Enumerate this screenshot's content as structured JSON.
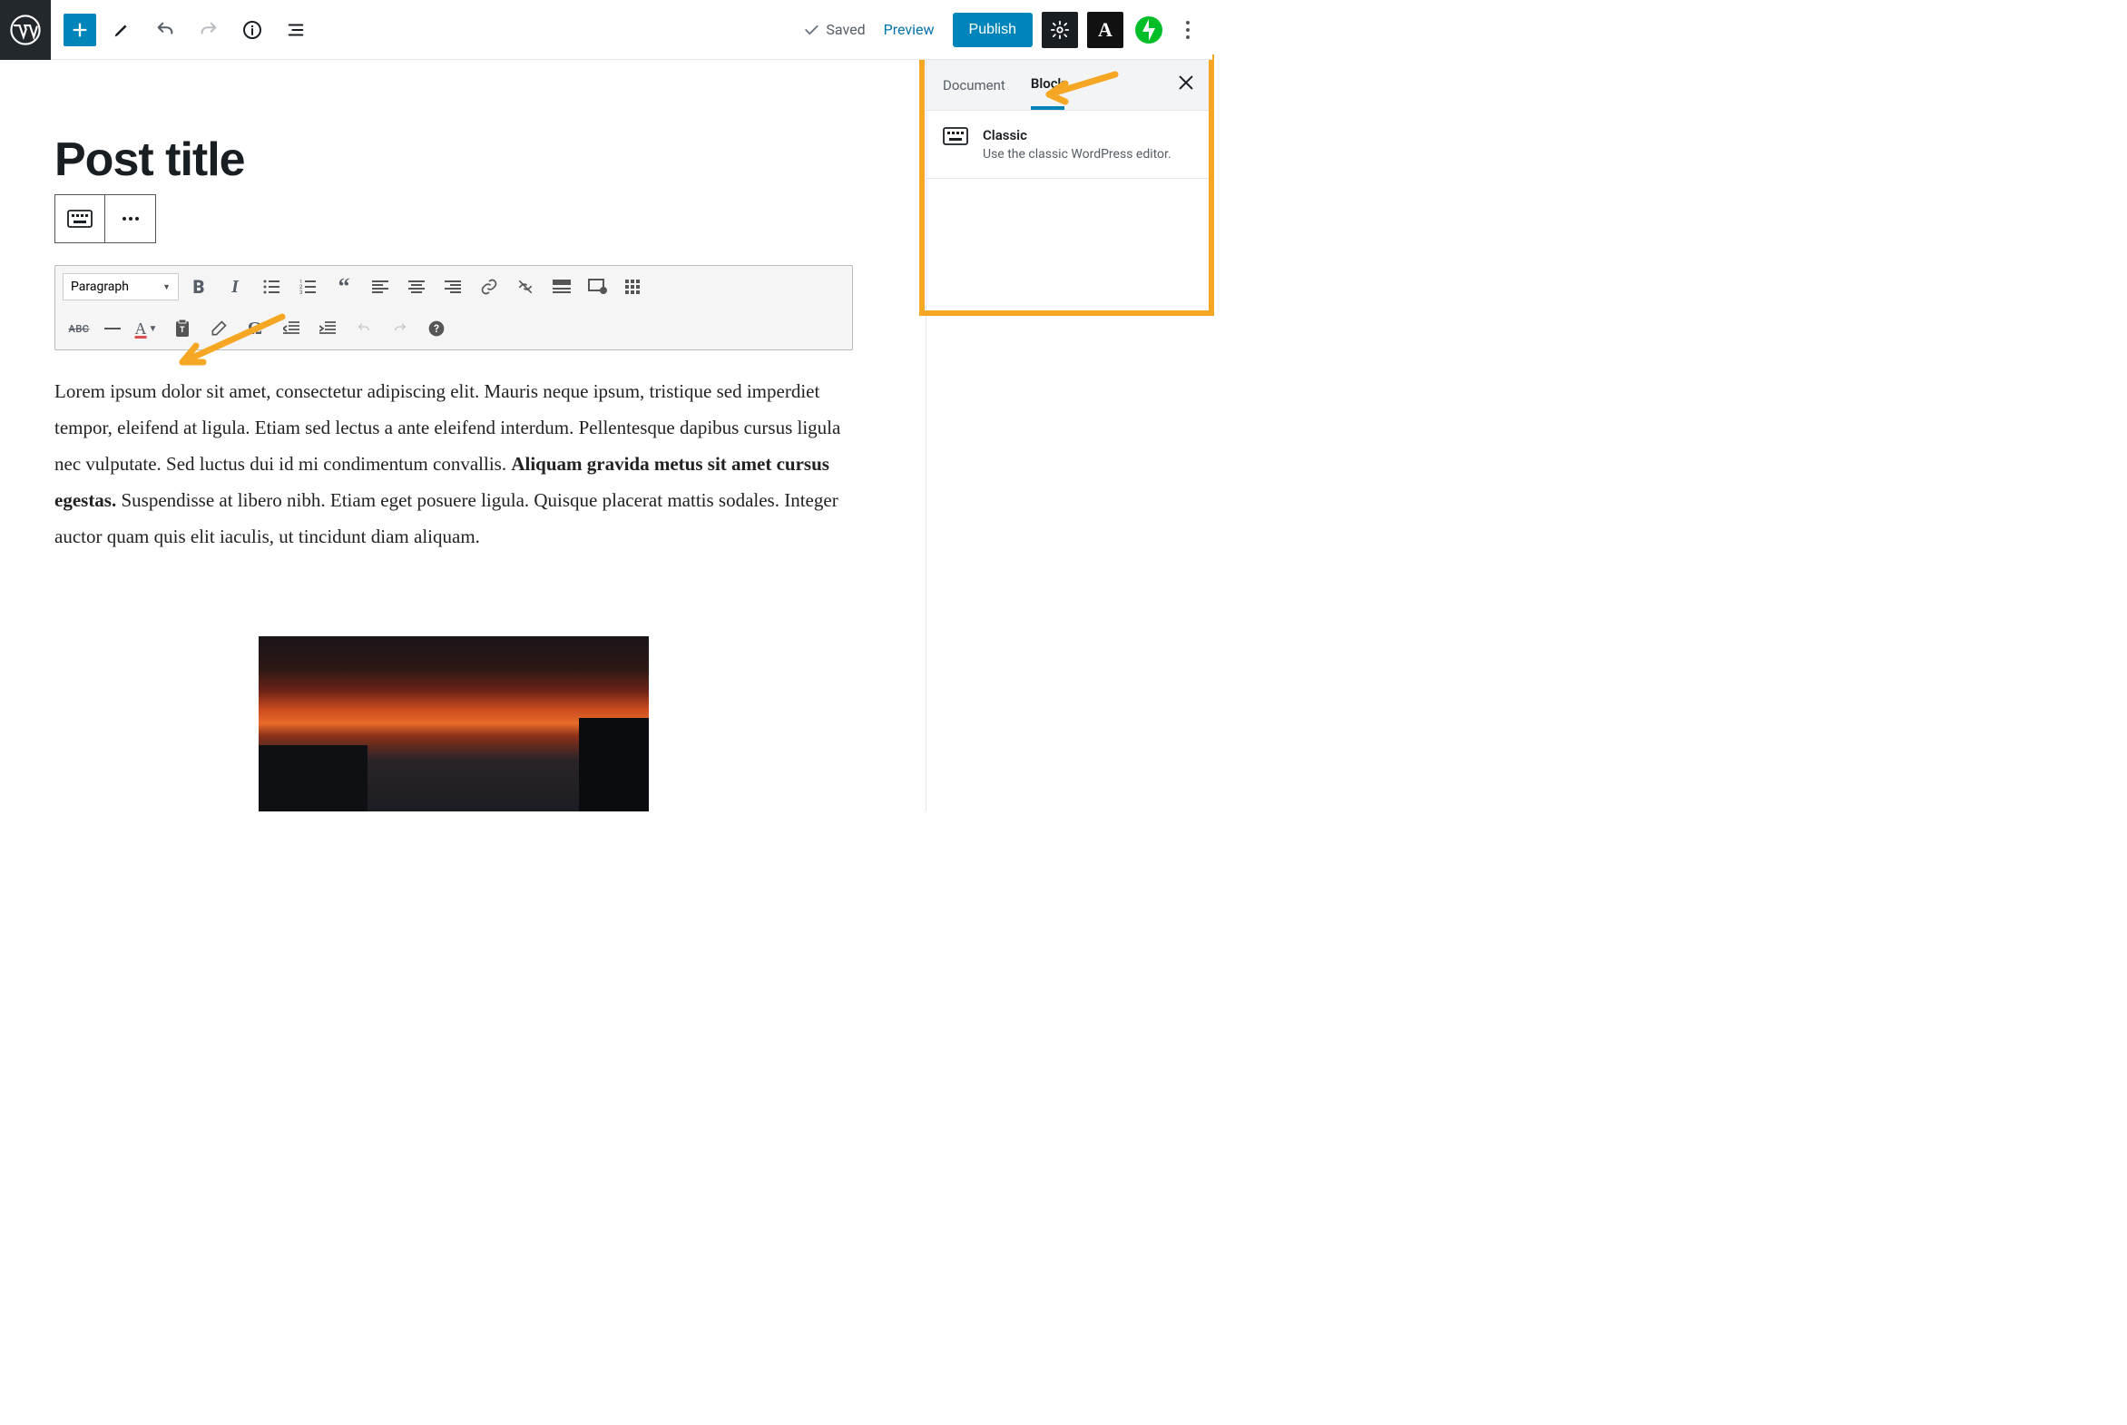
{
  "topbar": {
    "saved": "Saved",
    "preview": "Preview",
    "publish": "Publish",
    "amp": "A"
  },
  "editor": {
    "title": "Post title",
    "paragraph_label": "Paragraph",
    "abc": "ABC",
    "omega": "Ω",
    "content_pre": "Lorem ipsum dolor sit amet, consectetur adipiscing elit. Mauris neque ipsum, tristique sed imperdiet tempor, eleifend at ligula. Etiam sed lectus a ante eleifend interdum. Pellentesque dapibus cursus ligula nec vulputate. Sed luctus dui id mi condimentum convallis. ",
    "content_bold": "Aliquam gravida metus sit amet cursus egestas.",
    "content_post": " Suspendisse at libero nibh. Etiam eget posuere ligula. Quisque placerat mattis sodales. Integer auctor quam quis elit iaculis, ut tincidunt diam aliquam."
  },
  "sidebar": {
    "tab_document": "Document",
    "tab_block": "Block",
    "block_title": "Classic",
    "block_desc": "Use the classic WordPress editor."
  }
}
